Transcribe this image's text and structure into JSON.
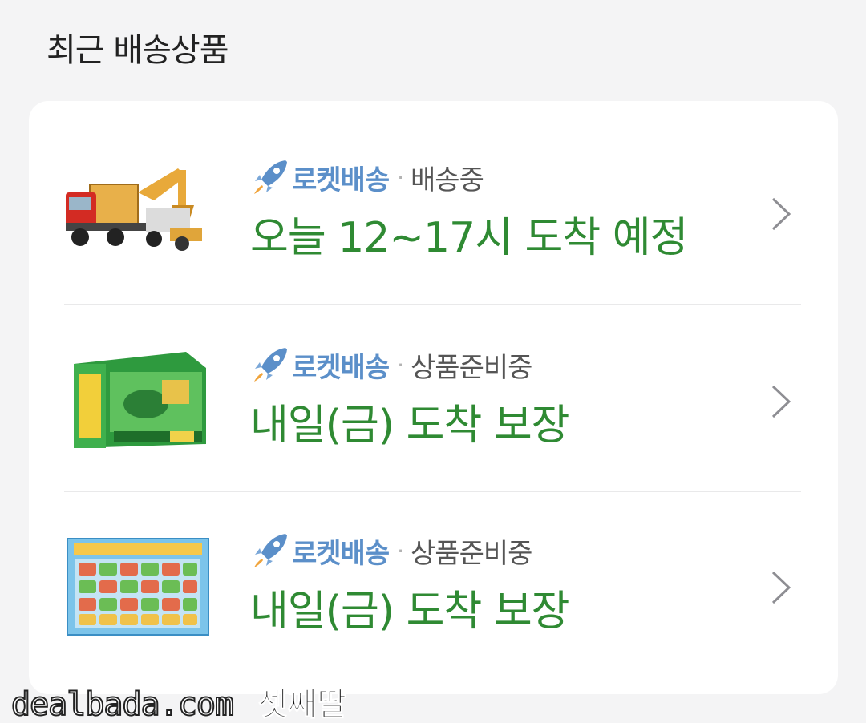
{
  "section": {
    "title": "최근 배송상품"
  },
  "deliveries": [
    {
      "brand": "로켓배송",
      "separator": "·",
      "status": "배송중",
      "eta": "오늘 12~17시 도착 예정",
      "thumbnail_icon": "truck-excavator-toy-image"
    },
    {
      "brand": "로켓배송",
      "separator": "·",
      "status": "상품준비중",
      "eta": "내일(금) 도착 보장",
      "thumbnail_icon": "green-toy-box-image"
    },
    {
      "brand": "로켓배송",
      "separator": "·",
      "status": "상품준비중",
      "eta": "내일(금) 도착 보장",
      "thumbnail_icon": "toy-car-set-image"
    }
  ],
  "watermark": {
    "site": "dealbada.com",
    "nick": "셋째딸"
  },
  "colors": {
    "brand_blue": "#5b8fc9",
    "eta_green": "#2f8a33",
    "status_gray": "#555555",
    "background": "#f4f4f5"
  }
}
